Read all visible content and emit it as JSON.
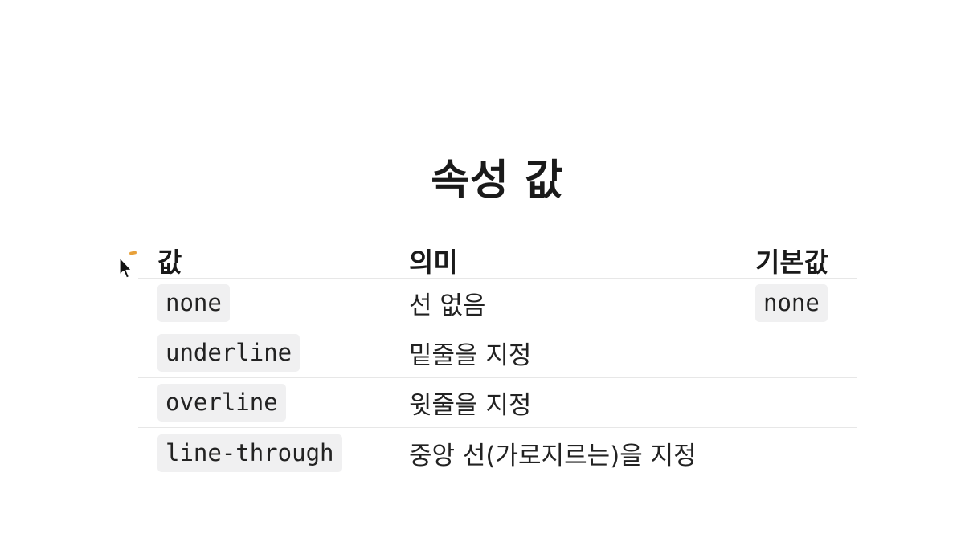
{
  "title": "속성 값",
  "table": {
    "headers": [
      "값",
      "의미",
      "기본값"
    ],
    "rows": [
      {
        "value": "none",
        "meaning": "선 없음",
        "default": "none"
      },
      {
        "value": "underline",
        "meaning": "밑줄을 지정",
        "default": ""
      },
      {
        "value": "overline",
        "meaning": "윗줄을 지정",
        "default": ""
      },
      {
        "value": "line-through",
        "meaning": "중앙 선(가로지르는)을 지정",
        "default": ""
      }
    ]
  },
  "colors": {
    "text": "#1f1f1f",
    "code_background": "#f0f0f1",
    "row_divider": "#e7e7e7",
    "drag_handle": "#e8a13a"
  },
  "icons": {
    "cursor": "mouse-pointer-icon",
    "drag_handle": "drag-handle-icon"
  }
}
